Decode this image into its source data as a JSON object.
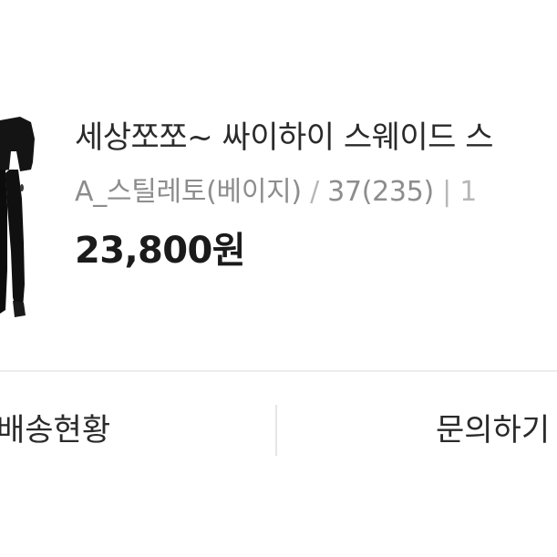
{
  "product": {
    "title": "세상쪼쪼~ 싸이하이 스웨이드 스",
    "option_name": "A_스틸레토(베이지)",
    "size": "37(235)",
    "option_separator": "/",
    "option_trailing": "| 1",
    "price": "23,800원",
    "thumbnail_icon": "boots-photo"
  },
  "actions": {
    "left_label": "배송현황",
    "right_label": "문의하기"
  },
  "colors": {
    "text_primary": "#1f1f1f",
    "text_secondary": "#8d8d8d",
    "divider": "#ececec"
  }
}
